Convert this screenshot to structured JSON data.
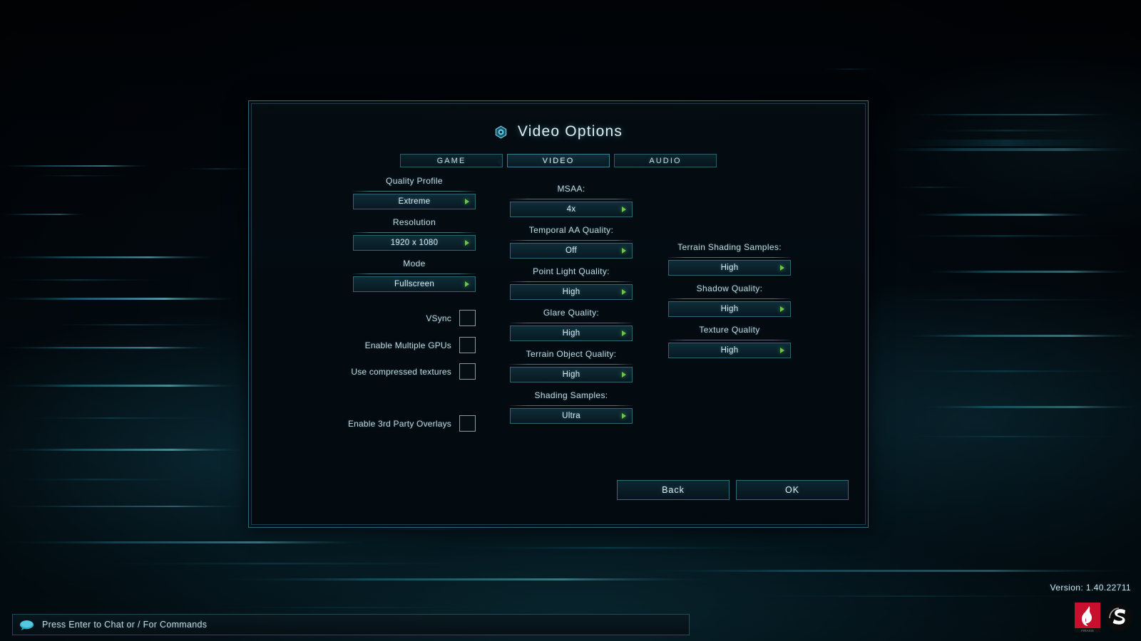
{
  "dialog": {
    "title": "Video Options",
    "title_icon": "hex-emblem-icon",
    "tabs": [
      {
        "label": "GAME",
        "active": false
      },
      {
        "label": "VIDEO",
        "active": true
      },
      {
        "label": "AUDIO",
        "active": false
      }
    ],
    "left_column": {
      "dropdowns": [
        {
          "label": "Quality Profile",
          "value": "Extreme"
        },
        {
          "label": "Resolution",
          "value": "1920 x 1080"
        },
        {
          "label": "Mode",
          "value": "Fullscreen"
        }
      ],
      "checkboxes": [
        {
          "label": "VSync",
          "checked": false
        },
        {
          "label": "Enable Multiple GPUs",
          "checked": false
        },
        {
          "label": "Use compressed textures",
          "checked": false
        },
        {
          "label": "Enable 3rd Party Overlays",
          "checked": false
        }
      ]
    },
    "middle_column": {
      "dropdowns": [
        {
          "label": "MSAA:",
          "value": "4x"
        },
        {
          "label": "Temporal AA Quality:",
          "value": "Off"
        },
        {
          "label": "Point Light Quality:",
          "value": "High"
        },
        {
          "label": "Glare Quality:",
          "value": "High"
        },
        {
          "label": "Terrain Object Quality:",
          "value": "High"
        },
        {
          "label": "Shading Samples:",
          "value": "Ultra"
        }
      ]
    },
    "right_column": {
      "dropdowns": [
        {
          "label": "Terrain Shading Samples:",
          "value": "High"
        },
        {
          "label": "Shadow Quality:",
          "value": "High"
        },
        {
          "label": "Texture Quality",
          "value": "High"
        }
      ]
    },
    "footer": {
      "back_label": "Back",
      "ok_label": "OK"
    }
  },
  "chat": {
    "icon": "speech-bubble-icon",
    "prompt": "Press Enter to Chat or / For Commands"
  },
  "version": "Version: 1.40.22711",
  "logos": [
    {
      "name": "firaxis-flame-logo"
    },
    {
      "name": "stardock-s-logo"
    }
  ],
  "colors": {
    "accent_border": "#2c6b77",
    "text_primary": "#dfeef2",
    "text_label": "#c3d8de",
    "arrow_green": "#6cc44a",
    "dialog_bg": "#040d13"
  }
}
